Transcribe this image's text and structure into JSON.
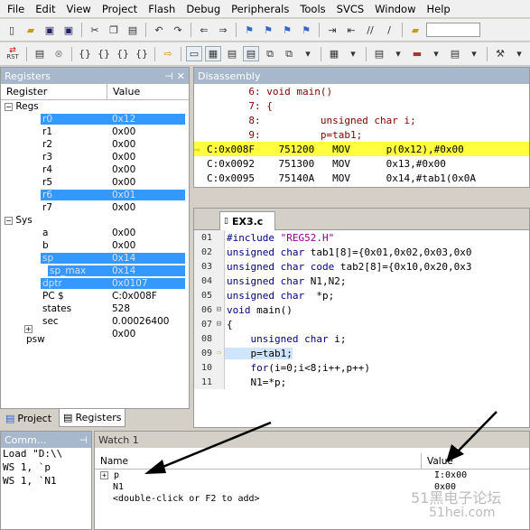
{
  "menu": [
    "File",
    "Edit",
    "View",
    "Project",
    "Flash",
    "Debug",
    "Peripherals",
    "Tools",
    "SVCS",
    "Window",
    "Help"
  ],
  "toolbar": {
    "reset_label": "RST"
  },
  "registers": {
    "title": "Registers",
    "col_register": "Register",
    "col_value": "Value",
    "groups": {
      "regs": "Regs",
      "sys": "Sys"
    },
    "rows": [
      {
        "name": "r0",
        "value": "0x12",
        "sel": true
      },
      {
        "name": "r1",
        "value": "0x00"
      },
      {
        "name": "r2",
        "value": "0x00"
      },
      {
        "name": "r3",
        "value": "0x00"
      },
      {
        "name": "r4",
        "value": "0x00"
      },
      {
        "name": "r5",
        "value": "0x00"
      },
      {
        "name": "r6",
        "value": "0x01",
        "sel": true
      },
      {
        "name": "r7",
        "value": "0x00"
      }
    ],
    "sys_rows": [
      {
        "name": "a",
        "value": "0x00"
      },
      {
        "name": "b",
        "value": "0x00"
      },
      {
        "name": "sp",
        "value": "0x14",
        "sel": true
      },
      {
        "name": "sp_max",
        "value": "0x14",
        "sel": true
      },
      {
        "name": "dptr",
        "value": "0x0107",
        "sel": true
      },
      {
        "name": "PC  $",
        "value": "C:0x008F"
      },
      {
        "name": "states",
        "value": "528"
      },
      {
        "name": "sec",
        "value": "0.00026400"
      },
      {
        "name": "psw",
        "value": "0x00"
      }
    ]
  },
  "left_tabs": {
    "project": "Project",
    "registers": "Registers"
  },
  "disassembly": {
    "title": "Disassembly",
    "lines": [
      {
        "text": "       6: void main()",
        "type": "src"
      },
      {
        "text": "       7: {",
        "type": "src"
      },
      {
        "text": "       8:          unsigned char i;",
        "type": "src"
      },
      {
        "text": "       9:          p=tab1;",
        "type": "src"
      },
      {
        "text": "C:0x008F    751200   MOV      p(0x12),#0x00",
        "type": "cur"
      },
      {
        "text": "C:0x0092    751300   MOV      0x13,#0x00",
        "type": "asm"
      },
      {
        "text": "C:0x0095    75140A   MOV      0x14,#tab1(0x0A",
        "type": "asm"
      }
    ]
  },
  "editor": {
    "tab": "EX3.c",
    "lines": [
      {
        "ln": "01",
        "pre": "",
        "kw": "#include ",
        "rest": "\"REG52.H\"",
        "restClass": "str"
      },
      {
        "ln": "02",
        "pre": "",
        "kw": "unsigned char ",
        "rest": "tab1[8]={0x01,0x02,0x03,0x0",
        "restClass": ""
      },
      {
        "ln": "03",
        "pre": "",
        "kw": "unsigned char code ",
        "rest": "tab2[8]={0x10,0x20,0x3",
        "restClass": ""
      },
      {
        "ln": "04",
        "pre": "",
        "kw": "unsigned char ",
        "rest": "N1,N2;",
        "restClass": ""
      },
      {
        "ln": "05",
        "pre": "",
        "kw": "unsigned char  ",
        "rest": "*p;",
        "restClass": ""
      },
      {
        "ln": "06",
        "pre": "",
        "kw": "void ",
        "rest": "main()",
        "restClass": ""
      },
      {
        "ln": "07",
        "pre": "",
        "kw": "",
        "rest": "{",
        "restClass": ""
      },
      {
        "ln": "08",
        "pre": "    ",
        "kw": "unsigned char ",
        "rest": "i;",
        "restClass": ""
      },
      {
        "ln": "09",
        "pre": "    ",
        "kw": "",
        "rest": "p=tab1;",
        "restClass": "",
        "hl": true
      },
      {
        "ln": "10",
        "pre": "    ",
        "kw": "for",
        "rest": "(i=0;i<8;i++,p++)",
        "restClass": ""
      },
      {
        "ln": "11",
        "pre": "    ",
        "kw": "",
        "rest": "N1=*p;",
        "restClass": ""
      }
    ]
  },
  "command": {
    "title": "Comm...",
    "lines": [
      "Load \"D:\\\\",
      "WS 1, `p",
      "WS 1, `N1"
    ]
  },
  "watch": {
    "title": "Watch 1",
    "col_name": "Name",
    "col_value": "Value",
    "rows": [
      {
        "name": "p",
        "value": "I:0x00",
        "expand": true
      },
      {
        "name": "N1",
        "value": "0x00"
      },
      {
        "name": "<double-click or F2 to add>",
        "value": ""
      }
    ]
  },
  "watermark": "51黑电子论坛",
  "watermark_url": "51hei.com"
}
